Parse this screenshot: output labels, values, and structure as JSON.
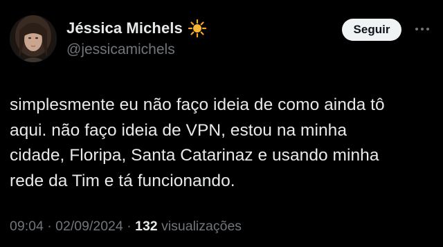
{
  "author": {
    "display_name": "Jéssica Michels",
    "handle": "@jessicamichels",
    "badge_icon": "sun-icon"
  },
  "actions": {
    "follow_label": "Seguir",
    "more_icon": "more-dots-icon"
  },
  "tweet": {
    "text_lines": [
      "simplesmente eu não faço ideia de como ainda tô",
      "aqui. não faço ideia de VPN, estou na minha",
      "cidade, Floripa, Santa Catarinaz e usando minha",
      "rede da Tim e tá funcionando."
    ],
    "time": "09:04",
    "separator": "·",
    "date": "02/09/2024",
    "views_count": "132",
    "views_label": "visualizações"
  },
  "colors": {
    "background": "#000000",
    "text_primary": "#e7e9ea",
    "text_secondary": "#71767b",
    "button_bg": "#eff3f4",
    "sun": "#f5a623"
  }
}
